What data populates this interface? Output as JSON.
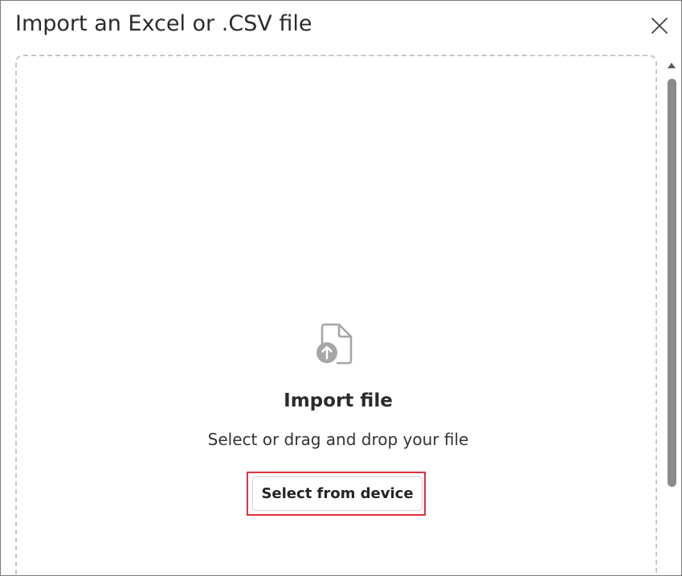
{
  "dialog": {
    "title": "Import an Excel or .CSV file",
    "close_icon": "close-icon"
  },
  "dropzone": {
    "icon": "file-upload-icon",
    "heading": "Import file",
    "subtext": "Select or drag and drop your file",
    "button_label": "Select from device"
  },
  "colors": {
    "highlight": "#e0323c",
    "dashed_border": "#c8c8c8",
    "icon": "#a6a6a6",
    "scrollbar_thumb": "#8a8a8a"
  }
}
